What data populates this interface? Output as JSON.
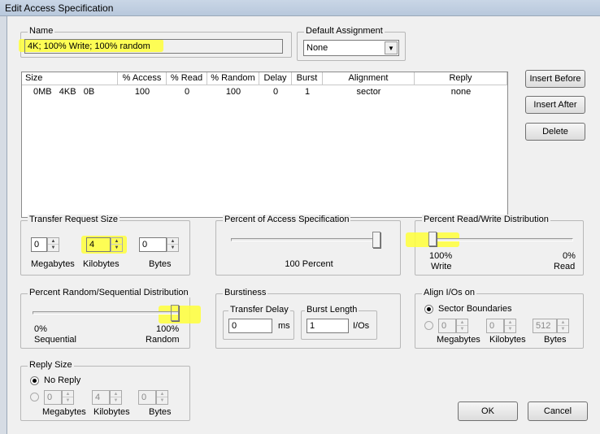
{
  "window": {
    "title": "Edit Access Specification"
  },
  "name_group": {
    "legend": "Name",
    "value": "4K; 100% Write; 100% random"
  },
  "default_assignment": {
    "legend": "Default Assignment",
    "value": "None"
  },
  "table": {
    "headers": [
      "Size",
      "% Access",
      "% Read",
      "% Random",
      "Delay",
      "Burst",
      "Alignment",
      "Reply"
    ],
    "row": {
      "size": "0MB   4KB   0B",
      "access": "100",
      "read": "0",
      "random": "100",
      "delay": "0",
      "burst": "1",
      "alignment": "sector",
      "reply": "none"
    }
  },
  "buttons": {
    "insert_before": "Insert Before",
    "insert_after": "Insert After",
    "delete": "Delete",
    "ok": "OK",
    "cancel": "Cancel"
  },
  "transfer_size": {
    "legend": "Transfer Request Size",
    "megabytes": "0",
    "kilobytes": "4",
    "bytes": "0",
    "lbl_mb": "Megabytes",
    "lbl_kb": "Kilobytes",
    "lbl_b": "Bytes"
  },
  "percent_access": {
    "legend": "Percent of Access Specification",
    "value_label": "100 Percent",
    "level": 1.0
  },
  "read_write": {
    "legend": "Percent Read/Write Distribution",
    "left_pct": "100%",
    "left_lbl": "Write",
    "right_pct": "0%",
    "right_lbl": "Read",
    "read_fraction": 0.0
  },
  "random_seq": {
    "legend": "Percent Random/Sequential Distribution",
    "left_pct": "0%",
    "left_lbl": "Sequential",
    "right_pct": "100%",
    "right_lbl": "Random",
    "random_fraction": 1.0
  },
  "burstiness": {
    "legend": "Burstiness",
    "delay_legend": "Transfer Delay",
    "delay_value": "0",
    "delay_unit": "ms",
    "burst_legend": "Burst Length",
    "burst_value": "1",
    "burst_unit": "I/Os"
  },
  "align": {
    "legend": "Align I/Os on",
    "option_sector": "Sector Boundaries",
    "mb": "0",
    "kb": "0",
    "b": "512",
    "lbl_mb": "Megabytes",
    "lbl_kb": "Kilobytes",
    "lbl_b": "Bytes"
  },
  "reply": {
    "legend": "Reply Size",
    "option_none": "No Reply",
    "mb": "0",
    "kb": "4",
    "b": "0",
    "lbl_mb": "Megabytes",
    "lbl_kb": "Kilobytes",
    "lbl_b": "Bytes"
  },
  "colors": {
    "highlight": "#ffff3a"
  }
}
